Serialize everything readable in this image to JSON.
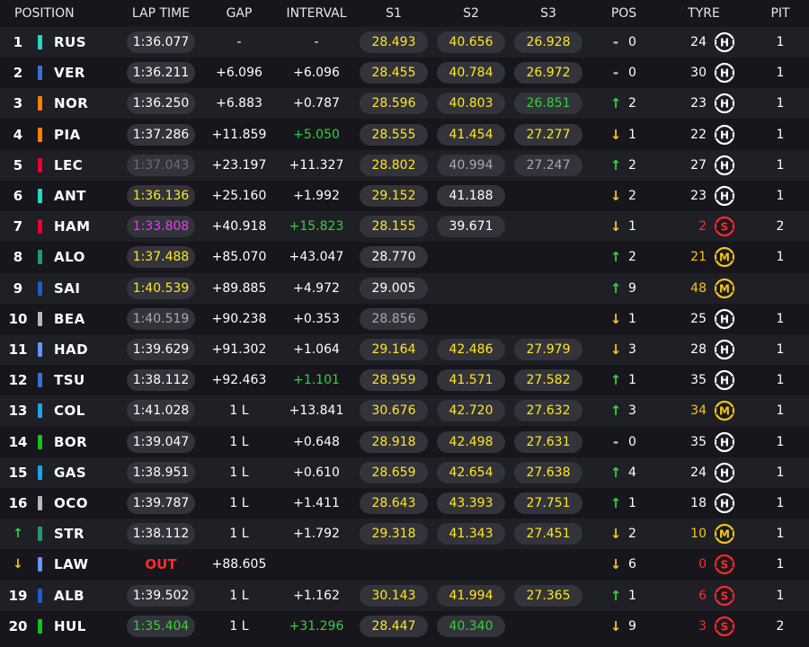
{
  "colors": {
    "yellow": "#ffe71c",
    "green": "#35d13b",
    "purple": "#e83cf0",
    "red": "#ff2a2a",
    "medium": "#f5c518",
    "white": "#ffffff",
    "grey": "#a8a8b0",
    "dim": "#6a6a72",
    "arrow_up": "#35d13b",
    "arrow_down": "#f5c518",
    "arrow_same": "#c8c8cc"
  },
  "headers": {
    "position": "POSITION",
    "lap_time": "LAP TIME",
    "gap": "GAP",
    "interval": "INTERVAL",
    "s1": "S1",
    "s2": "S2",
    "s3": "S3",
    "pos": "POS",
    "tyre": "TYRE",
    "pit": "PIT"
  },
  "rows": [
    {
      "pos": "1",
      "code": "RUS",
      "team": "#27d6c4",
      "lap": "1:36.077",
      "lap_c": "white",
      "gap": "-",
      "int": "-",
      "int_c": "white",
      "s1": "28.493",
      "s1_c": "yellow",
      "s2": "40.656",
      "s2_c": "yellow",
      "s3": "26.928",
      "s3_c": "yellow",
      "arrow": "same",
      "posch": "0",
      "tyre_age": "24",
      "tyre_c": "white",
      "tyre": "H",
      "pit": "1"
    },
    {
      "pos": "2",
      "code": "VER",
      "team": "#3a6fd8",
      "lap": "1:36.211",
      "lap_c": "white",
      "gap": "+6.096",
      "int": "+6.096",
      "int_c": "white",
      "s1": "28.455",
      "s1_c": "yellow",
      "s2": "40.784",
      "s2_c": "yellow",
      "s3": "26.972",
      "s3_c": "yellow",
      "arrow": "same",
      "posch": "0",
      "tyre_age": "30",
      "tyre_c": "white",
      "tyre": "H",
      "pit": "1"
    },
    {
      "pos": "3",
      "code": "NOR",
      "team": "#ff8000",
      "lap": "1:36.250",
      "lap_c": "white",
      "gap": "+6.883",
      "int": "+0.787",
      "int_c": "white",
      "s1": "28.596",
      "s1_c": "yellow",
      "s2": "40.803",
      "s2_c": "yellow",
      "s3": "26.851",
      "s3_c": "green",
      "arrow": "up",
      "posch": "2",
      "tyre_age": "23",
      "tyre_c": "white",
      "tyre": "H",
      "pit": "1"
    },
    {
      "pos": "4",
      "code": "PIA",
      "team": "#ff8000",
      "lap": "1:37.286",
      "lap_c": "white",
      "gap": "+11.859",
      "int": "+5.050",
      "int_c": "green",
      "s1": "28.555",
      "s1_c": "yellow",
      "s2": "41.454",
      "s2_c": "yellow",
      "s3": "27.277",
      "s3_c": "yellow",
      "arrow": "down",
      "posch": "1",
      "tyre_age": "22",
      "tyre_c": "white",
      "tyre": "H",
      "pit": "1"
    },
    {
      "pos": "5",
      "code": "LEC",
      "team": "#e8002d",
      "lap": "1:37.043",
      "lap_c": "dim",
      "gap": "+23.197",
      "int": "+11.327",
      "int_c": "white",
      "s1": "28.802",
      "s1_c": "yellow",
      "s2": "40.994",
      "s2_c": "grey",
      "s3": "27.247",
      "s3_c": "grey",
      "arrow": "up",
      "posch": "2",
      "tyre_age": "27",
      "tyre_c": "white",
      "tyre": "H",
      "pit": "1"
    },
    {
      "pos": "6",
      "code": "ANT",
      "team": "#27d6c4",
      "lap": "1:36.136",
      "lap_c": "yellow",
      "gap": "+25.160",
      "int": "+1.992",
      "int_c": "white",
      "s1": "29.152",
      "s1_c": "yellow",
      "s2": "41.188",
      "s2_c": "white",
      "s3": "",
      "s3_c": "white",
      "arrow": "down",
      "posch": "2",
      "tyre_age": "23",
      "tyre_c": "white",
      "tyre": "H",
      "pit": "1"
    },
    {
      "pos": "7",
      "code": "HAM",
      "team": "#e8002d",
      "lap": "1:33.808",
      "lap_c": "purple",
      "gap": "+40.918",
      "int": "+15.823",
      "int_c": "green",
      "s1": "28.155",
      "s1_c": "yellow",
      "s2": "39.671",
      "s2_c": "white",
      "s3": "",
      "s3_c": "white",
      "arrow": "down",
      "posch": "1",
      "tyre_age": "2",
      "tyre_c": "red",
      "tyre": "S",
      "pit": "2"
    },
    {
      "pos": "8",
      "code": "ALO",
      "team": "#229971",
      "lap": "1:37.488",
      "lap_c": "yellow",
      "gap": "+85.070",
      "int": "+43.047",
      "int_c": "white",
      "s1": "28.770",
      "s1_c": "white",
      "s2": "",
      "s2_c": "white",
      "s3": "",
      "s3_c": "white",
      "arrow": "up",
      "posch": "2",
      "tyre_age": "21",
      "tyre_c": "medium",
      "tyre": "M",
      "pit": "1"
    },
    {
      "pos": "9",
      "code": "SAI",
      "team": "#1e5bc6",
      "lap": "1:40.539",
      "lap_c": "yellow",
      "gap": "+89.885",
      "int": "+4.972",
      "int_c": "white",
      "s1": "29.005",
      "s1_c": "white",
      "s2": "",
      "s2_c": "white",
      "s3": "",
      "s3_c": "white",
      "arrow": "up",
      "posch": "9",
      "tyre_age": "48",
      "tyre_c": "medium",
      "tyre": "M",
      "pit": ""
    },
    {
      "pos": "10",
      "code": "BEA",
      "team": "#b6babd",
      "lap": "1:40.519",
      "lap_c": "grey",
      "gap": "+90.238",
      "int": "+0.353",
      "int_c": "white",
      "s1": "28.856",
      "s1_c": "grey",
      "s2": "",
      "s2_c": "white",
      "s3": "",
      "s3_c": "white",
      "arrow": "down",
      "posch": "1",
      "tyre_age": "25",
      "tyre_c": "white",
      "tyre": "H",
      "pit": "1"
    },
    {
      "pos": "11",
      "code": "HAD",
      "team": "#6692ff",
      "lap": "1:39.629",
      "lap_c": "white",
      "gap": "+91.302",
      "int": "+1.064",
      "int_c": "white",
      "s1": "29.164",
      "s1_c": "yellow",
      "s2": "42.486",
      "s2_c": "yellow",
      "s3": "27.979",
      "s3_c": "yellow",
      "arrow": "down",
      "posch": "3",
      "tyre_age": "28",
      "tyre_c": "white",
      "tyre": "H",
      "pit": "1"
    },
    {
      "pos": "12",
      "code": "TSU",
      "team": "#3a6fd8",
      "lap": "1:38.112",
      "lap_c": "white",
      "gap": "+92.463",
      "int": "+1.101",
      "int_c": "green",
      "s1": "28.959",
      "s1_c": "yellow",
      "s2": "41.571",
      "s2_c": "yellow",
      "s3": "27.582",
      "s3_c": "yellow",
      "arrow": "up",
      "posch": "1",
      "tyre_age": "35",
      "tyre_c": "white",
      "tyre": "H",
      "pit": "1"
    },
    {
      "pos": "13",
      "code": "COL",
      "team": "#1aa5e8",
      "lap": "1:41.028",
      "lap_c": "white",
      "gap": "1 L",
      "int": "+13.841",
      "int_c": "white",
      "s1": "30.676",
      "s1_c": "yellow",
      "s2": "42.720",
      "s2_c": "yellow",
      "s3": "27.632",
      "s3_c": "yellow",
      "arrow": "up",
      "posch": "3",
      "tyre_age": "34",
      "tyre_c": "medium",
      "tyre": "M",
      "pit": "1"
    },
    {
      "pos": "14",
      "code": "BOR",
      "team": "#18c21a",
      "lap": "1:39.047",
      "lap_c": "white",
      "gap": "1 L",
      "int": "+0.648",
      "int_c": "white",
      "s1": "28.918",
      "s1_c": "yellow",
      "s2": "42.498",
      "s2_c": "yellow",
      "s3": "27.631",
      "s3_c": "yellow",
      "arrow": "same",
      "posch": "0",
      "tyre_age": "35",
      "tyre_c": "white",
      "tyre": "H",
      "pit": "1"
    },
    {
      "pos": "15",
      "code": "GAS",
      "team": "#1aa5e8",
      "lap": "1:38.951",
      "lap_c": "white",
      "gap": "1 L",
      "int": "+0.610",
      "int_c": "white",
      "s1": "28.659",
      "s1_c": "yellow",
      "s2": "42.654",
      "s2_c": "yellow",
      "s3": "27.638",
      "s3_c": "yellow",
      "arrow": "up",
      "posch": "4",
      "tyre_age": "24",
      "tyre_c": "white",
      "tyre": "H",
      "pit": "1"
    },
    {
      "pos": "16",
      "code": "OCO",
      "team": "#b6babd",
      "lap": "1:39.787",
      "lap_c": "white",
      "gap": "1 L",
      "int": "+1.411",
      "int_c": "white",
      "s1": "28.643",
      "s1_c": "yellow",
      "s2": "43.393",
      "s2_c": "yellow",
      "s3": "27.751",
      "s3_c": "yellow",
      "arrow": "up",
      "posch": "1",
      "tyre_age": "18",
      "tyre_c": "white",
      "tyre": "H",
      "pit": "1"
    },
    {
      "pos": "",
      "pos_arrow": "up",
      "code": "STR",
      "team": "#229971",
      "lap": "1:38.112",
      "lap_c": "white",
      "gap": "1 L",
      "int": "+1.792",
      "int_c": "white",
      "s1": "29.318",
      "s1_c": "yellow",
      "s2": "41.343",
      "s2_c": "yellow",
      "s3": "27.451",
      "s3_c": "yellow",
      "arrow": "down",
      "posch": "2",
      "tyre_age": "10",
      "tyre_c": "medium",
      "tyre": "M",
      "pit": "1"
    },
    {
      "pos": "",
      "pos_arrow": "down",
      "code": "LAW",
      "team": "#6692ff",
      "lap": "OUT",
      "lap_c": "red",
      "out": true,
      "gap": "+88.605",
      "int": "",
      "int_c": "white",
      "s1": "",
      "s1_c": "white",
      "s2": "",
      "s2_c": "white",
      "s3": "",
      "s3_c": "white",
      "arrow": "down",
      "posch": "6",
      "tyre_age": "0",
      "tyre_c": "red",
      "tyre": "S",
      "pit": "1"
    },
    {
      "pos": "19",
      "code": "ALB",
      "team": "#1e5bc6",
      "lap": "1:39.502",
      "lap_c": "white",
      "gap": "1 L",
      "int": "+1.162",
      "int_c": "white",
      "s1": "30.143",
      "s1_c": "yellow",
      "s2": "41.994",
      "s2_c": "yellow",
      "s3": "27.365",
      "s3_c": "yellow",
      "arrow": "up",
      "posch": "1",
      "tyre_age": "6",
      "tyre_c": "red",
      "tyre": "S",
      "pit": "1"
    },
    {
      "pos": "20",
      "code": "HUL",
      "team": "#18c21a",
      "lap": "1:35.404",
      "lap_c": "green",
      "gap": "1 L",
      "int": "+31.296",
      "int_c": "green",
      "s1": "28.447",
      "s1_c": "yellow",
      "s2": "40.340",
      "s2_c": "green",
      "s3": "",
      "s3_c": "white",
      "arrow": "down",
      "posch": "9",
      "tyre_age": "3",
      "tyre_c": "red",
      "tyre": "S",
      "pit": "2"
    }
  ]
}
